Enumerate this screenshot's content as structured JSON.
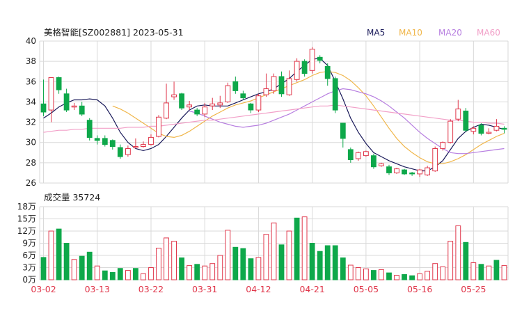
{
  "header": {
    "title": "美格智能[SZ002881] 2023-05-31",
    "ma_labels": [
      {
        "name": "MA5",
        "color": "#1a1a5a"
      },
      {
        "name": "MA10",
        "color": "#f0b64a"
      },
      {
        "name": "MA20",
        "color": "#b77ee0"
      },
      {
        "name": "MA60",
        "color": "#f2a0c8"
      }
    ]
  },
  "volume_title": "成交量 35724",
  "colors": {
    "up": "#e0364a",
    "down": "#0ea84a",
    "grid": "#d9d9d9",
    "axis_text": "#222222",
    "date_text": "#e0364a"
  },
  "chart_data": [
    {
      "type": "candlestick",
      "ylim": [
        26,
        40
      ],
      "yticks": [
        "40",
        "38",
        "36",
        "34",
        "32",
        "30",
        "28",
        "26"
      ],
      "xtick_labels": [
        "03-02",
        "03-13",
        "03-22",
        "03-31",
        "04-12",
        "04-21",
        "05-05",
        "05-16",
        "05-25"
      ],
      "xtick_index": [
        0,
        7,
        14,
        21,
        28,
        35,
        42,
        49,
        56
      ],
      "candles": [
        [
          33.8,
          33.0,
          36.2,
          32.6
        ],
        [
          33.2,
          36.4,
          36.4,
          32.0
        ],
        [
          36.4,
          35.2,
          36.5,
          34.8
        ],
        [
          34.8,
          33.2,
          35.3,
          33.0
        ],
        [
          33.5,
          33.6,
          33.9,
          33.2
        ],
        [
          33.6,
          32.8,
          34.0,
          32.6
        ],
        [
          32.2,
          30.5,
          32.4,
          30.2
        ],
        [
          30.4,
          30.2,
          30.7,
          29.8
        ],
        [
          30.4,
          29.8,
          30.7,
          29.6
        ],
        [
          30.2,
          29.6,
          30.3,
          29.3
        ],
        [
          29.5,
          28.6,
          29.8,
          28.4
        ],
        [
          28.8,
          29.4,
          29.7,
          28.6
        ],
        [
          29.5,
          29.6,
          30.4,
          29.4
        ],
        [
          29.6,
          29.8,
          30.1,
          29.5
        ],
        [
          29.8,
          30.5,
          30.8,
          29.7
        ],
        [
          30.6,
          32.5,
          32.7,
          30.5
        ],
        [
          32.4,
          33.9,
          35.8,
          32.3
        ],
        [
          34.5,
          34.7,
          36.0,
          34.2
        ],
        [
          34.8,
          33.4,
          34.9,
          33.2
        ],
        [
          33.5,
          33.7,
          34.1,
          33.2
        ],
        [
          33.2,
          32.8,
          33.4,
          32.6
        ],
        [
          32.8,
          33.5,
          33.9,
          32.5
        ],
        [
          33.6,
          33.8,
          34.4,
          33.2
        ],
        [
          33.7,
          33.9,
          34.6,
          33.4
        ],
        [
          34.0,
          35.6,
          35.9,
          33.9
        ],
        [
          36.0,
          35.1,
          36.5,
          34.8
        ],
        [
          34.8,
          34.4,
          35.1,
          34.2
        ],
        [
          33.8,
          33.2,
          33.9,
          32.9
        ],
        [
          33.2,
          34.6,
          34.8,
          33.0
        ],
        [
          34.7,
          35.3,
          36.8,
          34.5
        ],
        [
          35.1,
          36.5,
          36.8,
          34.8
        ],
        [
          36.5,
          34.8,
          37.0,
          34.5
        ],
        [
          34.7,
          36.3,
          37.1,
          34.6
        ],
        [
          36.2,
          38.0,
          38.3,
          36.0
        ],
        [
          38.0,
          36.8,
          38.2,
          36.5
        ],
        [
          37.1,
          39.2,
          39.4,
          36.8
        ],
        [
          38.4,
          38.1,
          38.6,
          37.8
        ],
        [
          37.5,
          36.3,
          37.8,
          35.6
        ],
        [
          36.3,
          33.2,
          36.5,
          32.9
        ],
        [
          31.9,
          30.4,
          30.9,
          29.5
        ],
        [
          29.3,
          28.3,
          29.5,
          28.0
        ],
        [
          28.4,
          29.0,
          29.1,
          28.2
        ],
        [
          28.7,
          29.1,
          29.2,
          28.6
        ],
        [
          28.7,
          27.6,
          28.9,
          27.4
        ],
        [
          27.7,
          27.9,
          28.0,
          27.6
        ],
        [
          27.6,
          27.0,
          27.8,
          26.8
        ],
        [
          27.0,
          27.4,
          27.5,
          26.9
        ],
        [
          27.3,
          26.9,
          27.4,
          26.8
        ],
        [
          27.0,
          26.9,
          27.1,
          26.7
        ],
        [
          26.9,
          27.3,
          27.4,
          26.6
        ],
        [
          26.8,
          27.5,
          27.7,
          26.7
        ],
        [
          27.2,
          29.4,
          29.6,
          27.1
        ],
        [
          29.4,
          30.0,
          30.1,
          29.2
        ],
        [
          30.0,
          32.1,
          32.3,
          29.9
        ],
        [
          32.3,
          33.3,
          34.2,
          32.1
        ],
        [
          33.1,
          31.2,
          33.4,
          31.0
        ],
        [
          31.1,
          31.4,
          31.6,
          30.8
        ],
        [
          31.7,
          30.9,
          31.9,
          30.7
        ],
        [
          30.9,
          31.0,
          31.4,
          30.8
        ],
        [
          31.2,
          31.6,
          32.3,
          31.1
        ],
        [
          31.4,
          31.3,
          31.6,
          30.9
        ]
      ],
      "ma_lines": {
        "MA5": [
          32.4,
          32.9,
          33.5,
          33.9,
          34.2,
          34.2,
          34.3,
          34.2,
          33.6,
          32.4,
          31.0,
          30.0,
          29.4,
          29.2,
          29.4,
          29.8,
          30.6,
          31.5,
          32.4,
          33.2,
          33.6,
          33.7,
          33.6,
          33.6,
          33.6,
          33.9,
          34.2,
          34.5,
          34.8,
          35.0,
          35.3,
          35.8,
          36.3,
          37.0,
          37.6,
          38.2,
          38.3,
          37.6,
          36.0,
          34.3,
          32.4,
          31.0,
          29.9,
          29.0,
          28.6,
          28.2,
          27.9,
          27.6,
          27.4,
          27.2,
          27.2,
          27.6,
          28.2,
          29.3,
          30.4,
          31.1,
          31.5,
          31.8,
          31.7,
          31.5,
          31.3
        ],
        "MA10": [
          null,
          null,
          null,
          null,
          null,
          null,
          null,
          null,
          null,
          33.6,
          33.3,
          32.9,
          32.4,
          31.9,
          31.4,
          30.9,
          30.6,
          30.5,
          30.7,
          31.1,
          31.6,
          32.1,
          32.6,
          33.0,
          33.4,
          33.7,
          33.9,
          34.1,
          34.4,
          34.7,
          35.0,
          35.3,
          35.6,
          35.9,
          36.2,
          36.6,
          36.9,
          37.0,
          36.9,
          36.6,
          36.1,
          35.4,
          34.6,
          33.6,
          32.5,
          31.4,
          30.4,
          29.6,
          29.0,
          28.5,
          28.1,
          27.9,
          27.9,
          28.1,
          28.4,
          28.8,
          29.3,
          29.8,
          30.2,
          30.6,
          30.9
        ],
        "MA20": [
          null,
          null,
          null,
          null,
          null,
          null,
          null,
          null,
          null,
          null,
          null,
          null,
          null,
          null,
          null,
          null,
          null,
          null,
          null,
          33.1,
          32.9,
          32.6,
          32.3,
          32.0,
          31.8,
          31.6,
          31.5,
          31.6,
          31.7,
          31.9,
          32.2,
          32.5,
          32.8,
          33.2,
          33.6,
          34.0,
          34.4,
          34.8,
          35.1,
          35.3,
          35.2,
          35.0,
          34.8,
          34.5,
          34.1,
          33.6,
          33.0,
          32.4,
          31.7,
          31.0,
          30.4,
          29.9,
          29.4,
          29.0,
          28.9,
          28.9,
          29.0,
          29.1,
          29.2,
          29.3,
          29.4
        ],
        "MA60": [
          31.0,
          31.1,
          31.2,
          31.2,
          31.3,
          31.3,
          31.4,
          31.4,
          31.4,
          31.4,
          31.4,
          31.5,
          31.5,
          31.5,
          31.6,
          31.6,
          31.7,
          31.8,
          31.9,
          32.0,
          32.1,
          32.2,
          32.2,
          32.3,
          32.4,
          32.5,
          32.6,
          32.7,
          32.8,
          32.9,
          33.0,
          33.1,
          33.2,
          33.3,
          33.4,
          33.5,
          33.6,
          33.6,
          33.7,
          33.6,
          33.5,
          33.4,
          33.3,
          33.2,
          33.1,
          33.0,
          32.9,
          32.8,
          32.7,
          32.6,
          32.5,
          32.4,
          32.3,
          32.2,
          32.2,
          32.1,
          32.0,
          32.0,
          31.9,
          31.9,
          31.8
        ]
      }
    },
    {
      "type": "bar",
      "ylim": [
        0,
        18
      ],
      "yticks": [
        "18万",
        "15万",
        "12万",
        "9万",
        "6万",
        "3万",
        "0万"
      ],
      "volumes": [
        5.5,
        12.0,
        12.5,
        9.0,
        5.0,
        5.8,
        6.8,
        3.4,
        2.2,
        1.8,
        2.8,
        2.3,
        2.8,
        1.5,
        3.0,
        7.8,
        10.3,
        9.5,
        5.4,
        3.5,
        3.8,
        3.4,
        4.0,
        6.0,
        12.2,
        8.0,
        7.7,
        5.2,
        5.5,
        11.2,
        14.0,
        8.6,
        12.0,
        15.2,
        15.5,
        9.0,
        7.0,
        8.4,
        8.4,
        5.4,
        3.6,
        3.0,
        2.7,
        2.3,
        2.5,
        1.7,
        1.1,
        1.3,
        1.0,
        1.5,
        2.1,
        4.0,
        3.2,
        9.5,
        13.3,
        9.2,
        4.2,
        3.8,
        3.4,
        4.8,
        3.5
      ],
      "up_flags": [
        false,
        true,
        false,
        false,
        true,
        false,
        false,
        true,
        false,
        false,
        false,
        true,
        false,
        true,
        true,
        true,
        true,
        true,
        false,
        true,
        false,
        true,
        true,
        true,
        true,
        false,
        false,
        false,
        true,
        true,
        true,
        false,
        true,
        false,
        true,
        false,
        false,
        false,
        false,
        false,
        true,
        true,
        true,
        false,
        true,
        false,
        true,
        false,
        false,
        true,
        true,
        true,
        true,
        true,
        true,
        false,
        true,
        false,
        true,
        false,
        true
      ]
    }
  ]
}
